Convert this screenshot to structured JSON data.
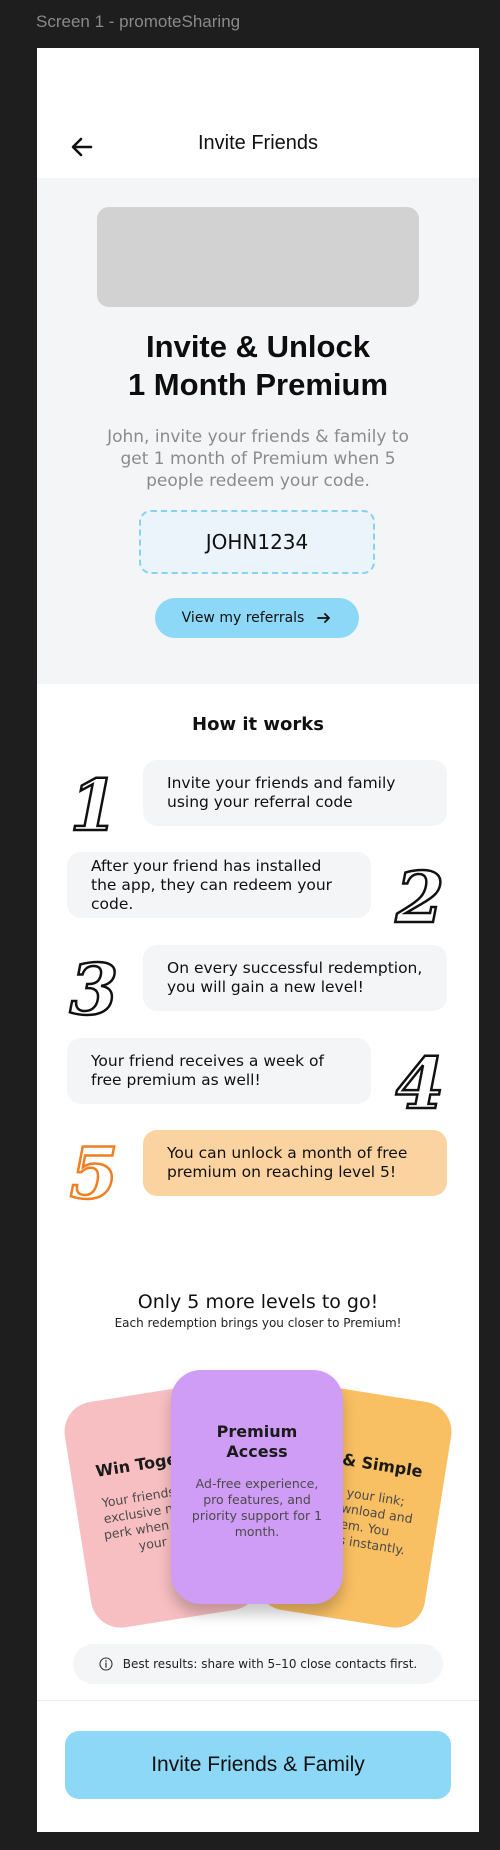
{
  "frame": {
    "label": "Screen 1 - promoteSharing"
  },
  "header": {
    "title": "Invite Friends",
    "back_icon": "arrow-left-icon"
  },
  "hero": {
    "title_line1": "Invite & Unlock",
    "title_line2": "1 Month Premium",
    "description": "John, invite your friends & family to get 1 month of Premium when 5 people redeem your code.",
    "referral_code": "JOHN1234",
    "referrals_button_label": "View my referrals",
    "referrals_button_icon": "arrow-right-icon"
  },
  "how_it_works": {
    "title": "How it works",
    "steps": [
      {
        "number": "1",
        "text": "Invite your friends and family using your referral code"
      },
      {
        "number": "2",
        "text": "After your friend has installed the app, they can redeem your code."
      },
      {
        "number": "3",
        "text": "On every successful redemption, you will gain a new level!"
      },
      {
        "number": "4",
        "text": "Your friend receives a week of free premium as well!"
      },
      {
        "number": "5",
        "text": "You can unlock a month of free premium on reaching level 5!"
      }
    ]
  },
  "levels": {
    "title": "Only 5 more levels to go!",
    "subtitle": "Each redemption brings you closer to Premium!"
  },
  "perk_cards": [
    {
      "title": "Win Together",
      "description": "Your friends get an exclusive new user perk when they use your link."
    },
    {
      "title": "Premium Access",
      "description": "Ad-free experience, pro features, and priority support for 1 month."
    },
    {
      "title": "Fast & Simple",
      "description": "Share your link; they download and redeem. You progress instantly."
    }
  ],
  "tip": {
    "icon": "info-icon",
    "text": "Best results: share with 5–10 close contacts first."
  },
  "cta": {
    "label": "Invite Friends & Family"
  },
  "colors": {
    "accent_blue": "#8dd8f7",
    "highlight_orange": "#fbd3a1",
    "number_orange": "#f07f22",
    "card_pink": "#f8bfc2",
    "card_purple": "#cf9df5",
    "card_yellow": "#f9bf63"
  }
}
